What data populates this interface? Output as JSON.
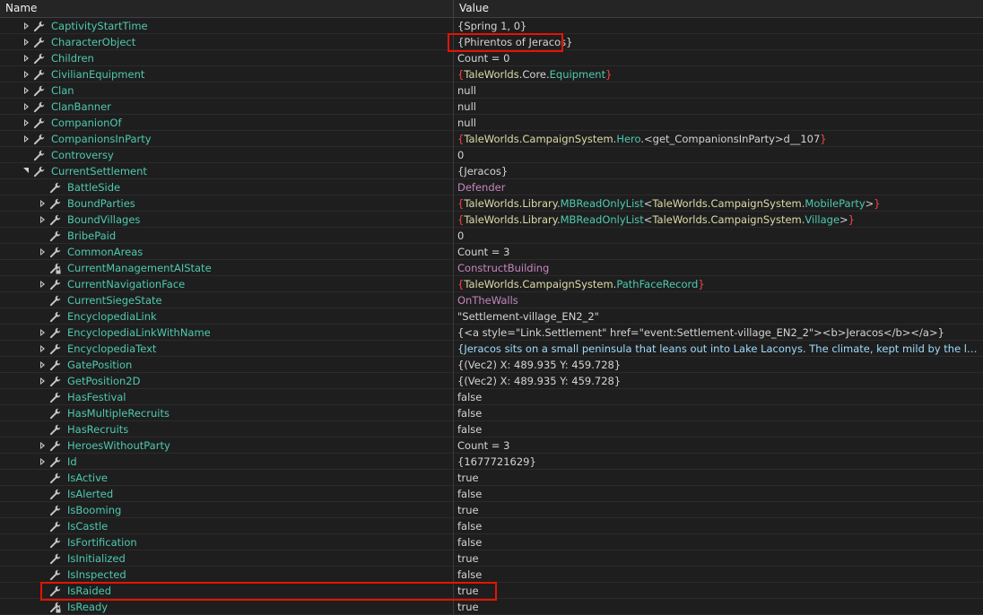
{
  "header": {
    "name_label": "Name",
    "value_label": "Value"
  },
  "colors": {
    "highlight": "#e51400",
    "property": "#4ec9b0",
    "enum": "#c586c0"
  },
  "rows": [
    {
      "depth": 0,
      "expand": "collapsed",
      "icon": "wrench-icon",
      "name": "CaptivityStartTime",
      "value": "{Spring 1, 0}",
      "style": "white"
    },
    {
      "depth": 0,
      "expand": "collapsed",
      "icon": "wrench-icon",
      "name": "CharacterObject",
      "value": "{Phirentos of Jeracos}",
      "style": "white"
    },
    {
      "depth": 0,
      "expand": "collapsed",
      "icon": "wrench-icon",
      "name": "Children",
      "value": "Count = 0",
      "style": "white"
    },
    {
      "depth": 0,
      "expand": "collapsed",
      "icon": "wrench-icon",
      "name": "CivilianEquipment",
      "value": "{TaleWorlds.Core.Equipment}",
      "style": "type",
      "parts": [
        [
          "{",
          "red"
        ],
        [
          "TaleWorlds",
          "yellow"
        ],
        [
          ".Core.",
          "white"
        ],
        [
          "Equipment",
          "cyan"
        ],
        [
          "}",
          "red"
        ]
      ]
    },
    {
      "depth": 0,
      "expand": "collapsed",
      "icon": "wrench-icon",
      "name": "Clan",
      "value": "null",
      "style": "white"
    },
    {
      "depth": 0,
      "expand": "collapsed",
      "icon": "wrench-icon",
      "name": "ClanBanner",
      "value": "null",
      "style": "white"
    },
    {
      "depth": 0,
      "expand": "collapsed",
      "icon": "wrench-icon",
      "name": "CompanionOf",
      "value": "null",
      "style": "white"
    },
    {
      "depth": 0,
      "expand": "collapsed",
      "icon": "wrench-icon",
      "name": "CompanionsInParty",
      "value": "{TaleWorlds.CampaignSystem.Hero.<get_CompanionsInParty>d__107}",
      "style": "type",
      "parts": [
        [
          "{",
          "red"
        ],
        [
          "TaleWorlds.CampaignSystem",
          "yellow"
        ],
        [
          ".",
          "white"
        ],
        [
          "Hero",
          "cyan"
        ],
        [
          ".<get_CompanionsInParty>d__107",
          "white"
        ],
        [
          "}",
          "red"
        ]
      ]
    },
    {
      "depth": 0,
      "expand": "none",
      "icon": "wrench-icon",
      "name": "Controversy",
      "value": "0",
      "style": "white"
    },
    {
      "depth": 0,
      "expand": "expanded",
      "icon": "wrench-icon",
      "name": "CurrentSettlement",
      "value": "{Jeracos}",
      "style": "white"
    },
    {
      "depth": 1,
      "expand": "none",
      "icon": "wrench-icon",
      "name": "BattleSide",
      "value": "Defender",
      "style": "purple"
    },
    {
      "depth": 1,
      "expand": "collapsed",
      "icon": "wrench-icon",
      "name": "BoundParties",
      "value": "{TaleWorlds.Library.MBReadOnlyList<TaleWorlds.CampaignSystem.MobileParty>}",
      "style": "type",
      "parts": [
        [
          "{",
          "red"
        ],
        [
          "TaleWorlds.Library",
          "yellow"
        ],
        [
          ".",
          "white"
        ],
        [
          "MBReadOnlyList",
          "cyan"
        ],
        [
          "<",
          "white"
        ],
        [
          "TaleWorlds.CampaignSystem",
          "yellow"
        ],
        [
          ".",
          "white"
        ],
        [
          "MobileParty",
          "cyan"
        ],
        [
          ">",
          "white"
        ],
        [
          "}",
          "red"
        ]
      ]
    },
    {
      "depth": 1,
      "expand": "collapsed",
      "icon": "wrench-icon",
      "name": "BoundVillages",
      "value": "{TaleWorlds.Library.MBReadOnlyList<TaleWorlds.CampaignSystem.Village>}",
      "style": "type",
      "parts": [
        [
          "{",
          "red"
        ],
        [
          "TaleWorlds.Library",
          "yellow"
        ],
        [
          ".",
          "white"
        ],
        [
          "MBReadOnlyList",
          "cyan"
        ],
        [
          "<",
          "white"
        ],
        [
          "TaleWorlds.CampaignSystem",
          "yellow"
        ],
        [
          ".",
          "white"
        ],
        [
          "Village",
          "cyan"
        ],
        [
          ">",
          "white"
        ],
        [
          "}",
          "red"
        ]
      ]
    },
    {
      "depth": 1,
      "expand": "none",
      "icon": "wrench-icon",
      "name": "BribePaid",
      "value": "0",
      "style": "white"
    },
    {
      "depth": 1,
      "expand": "collapsed",
      "icon": "wrench-icon",
      "name": "CommonAreas",
      "value": "Count = 3",
      "style": "white"
    },
    {
      "depth": 1,
      "expand": "none",
      "icon": "wrench-lock-icon",
      "name": "CurrentManagementAIState",
      "value": "ConstructBuilding",
      "style": "purple"
    },
    {
      "depth": 1,
      "expand": "collapsed",
      "icon": "wrench-icon",
      "name": "CurrentNavigationFace",
      "value": "{TaleWorlds.CampaignSystem.PathFaceRecord}",
      "style": "type",
      "parts": [
        [
          "{",
          "red"
        ],
        [
          "TaleWorlds.CampaignSystem",
          "yellow"
        ],
        [
          ".",
          "white"
        ],
        [
          "PathFaceRecord",
          "green"
        ],
        [
          "}",
          "red"
        ]
      ]
    },
    {
      "depth": 1,
      "expand": "none",
      "icon": "wrench-icon",
      "name": "CurrentSiegeState",
      "value": "OnTheWalls",
      "style": "purple"
    },
    {
      "depth": 1,
      "expand": "none",
      "icon": "wrench-icon",
      "name": "EncyclopediaLink",
      "value": "\"Settlement-village_EN2_2\"",
      "style": "white"
    },
    {
      "depth": 1,
      "expand": "collapsed",
      "icon": "wrench-icon",
      "name": "EncyclopediaLinkWithName",
      "value": "{<a style=\"Link.Settlement\" href=\"event:Settlement-village_EN2_2\"><b>Jeracos</b></a>}",
      "style": "white"
    },
    {
      "depth": 1,
      "expand": "collapsed",
      "icon": "wrench-icon",
      "name": "EncyclopediaText",
      "value": "{Jeracos sits on a small peninsula that leans out into Lake Laconys. The climate, kept mild by the lake breezes,...",
      "style": "blue"
    },
    {
      "depth": 1,
      "expand": "collapsed",
      "icon": "wrench-icon",
      "name": "GatePosition",
      "value": "{(Vec2) X: 489.935 Y: 459.728}",
      "style": "white"
    },
    {
      "depth": 1,
      "expand": "collapsed",
      "icon": "wrench-icon",
      "name": "GetPosition2D",
      "value": "{(Vec2) X: 489.935 Y: 459.728}",
      "style": "white"
    },
    {
      "depth": 1,
      "expand": "none",
      "icon": "wrench-icon",
      "name": "HasFestival",
      "value": "false",
      "style": "white"
    },
    {
      "depth": 1,
      "expand": "none",
      "icon": "wrench-icon",
      "name": "HasMultipleRecruits",
      "value": "false",
      "style": "white"
    },
    {
      "depth": 1,
      "expand": "none",
      "icon": "wrench-icon",
      "name": "HasRecruits",
      "value": "false",
      "style": "white"
    },
    {
      "depth": 1,
      "expand": "collapsed",
      "icon": "wrench-icon",
      "name": "HeroesWithoutParty",
      "value": "Count = 3",
      "style": "white"
    },
    {
      "depth": 1,
      "expand": "collapsed",
      "icon": "wrench-icon",
      "name": "Id",
      "value": "{1677721629}",
      "style": "white"
    },
    {
      "depth": 1,
      "expand": "none",
      "icon": "wrench-icon",
      "name": "IsActive",
      "value": "true",
      "style": "white"
    },
    {
      "depth": 1,
      "expand": "none",
      "icon": "wrench-icon",
      "name": "IsAlerted",
      "value": "false",
      "style": "white"
    },
    {
      "depth": 1,
      "expand": "none",
      "icon": "wrench-icon",
      "name": "IsBooming",
      "value": "true",
      "style": "white"
    },
    {
      "depth": 1,
      "expand": "none",
      "icon": "wrench-icon",
      "name": "IsCastle",
      "value": "false",
      "style": "white"
    },
    {
      "depth": 1,
      "expand": "none",
      "icon": "wrench-icon",
      "name": "IsFortification",
      "value": "false",
      "style": "white"
    },
    {
      "depth": 1,
      "expand": "none",
      "icon": "wrench-icon",
      "name": "IsInitialized",
      "value": "true",
      "style": "white"
    },
    {
      "depth": 1,
      "expand": "none",
      "icon": "wrench-icon",
      "name": "IsInspected",
      "value": "false",
      "style": "white"
    },
    {
      "depth": 1,
      "expand": "none",
      "icon": "wrench-icon",
      "name": "IsRaided",
      "value": "true",
      "style": "white"
    },
    {
      "depth": 1,
      "expand": "none",
      "icon": "wrench-lock-icon",
      "name": "IsReady",
      "value": "true",
      "style": "white"
    }
  ]
}
